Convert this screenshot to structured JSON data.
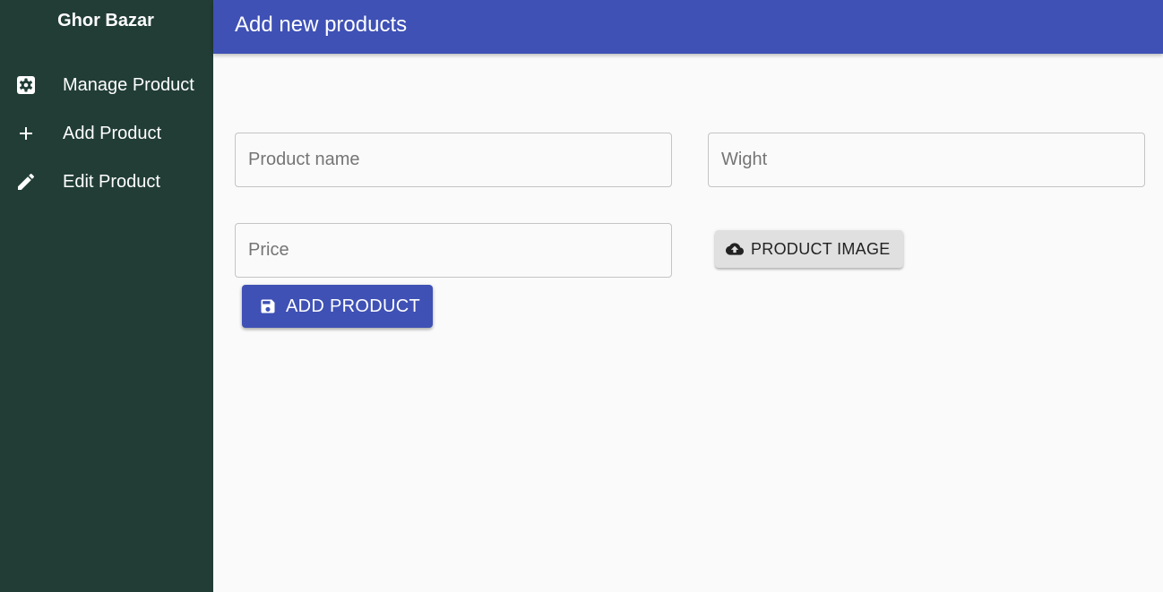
{
  "sidebar": {
    "brand": "Ghor Bazar",
    "items": [
      {
        "label": "Manage Product",
        "icon": "gear-box-icon"
      },
      {
        "label": "Add Product",
        "icon": "plus-icon"
      },
      {
        "label": "Edit Product",
        "icon": "pencil-icon"
      }
    ]
  },
  "header": {
    "title": "Add new products"
  },
  "form": {
    "product_name_placeholder": "Product name",
    "weight_placeholder": "Wight",
    "price_placeholder": "Price",
    "upload_label": "PRODUCT IMAGE",
    "upload_icon": "cloud-upload-icon",
    "submit_label": "ADD PRODUCT",
    "submit_icon": "save-icon"
  },
  "colors": {
    "sidebar_bg": "#213d36",
    "appbar_bg": "#3f51b5",
    "primary_button": "#3f51b5",
    "secondary_button": "#e0e0e0",
    "page_bg": "#fafafa"
  }
}
